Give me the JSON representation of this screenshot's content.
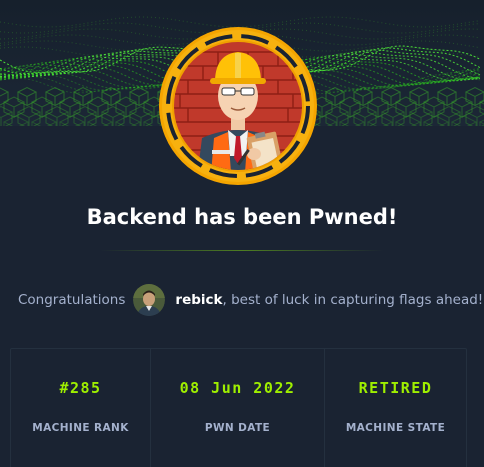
{
  "colors": {
    "background": "#1a2332",
    "accent_green": "#9fef00",
    "muted_text": "#a4b1cd",
    "ring_orange": "#f5a500"
  },
  "banner": {
    "icon": "green-wireframe-landscape-art"
  },
  "machine": {
    "avatar_icon": "construction-worker-avatar-icon",
    "title": "Backend has been Pwned!"
  },
  "congrats": {
    "prefix": "Congratulations",
    "user_avatar_icon": "user-avatar-icon",
    "username": "rebick",
    "suffix": ", best of luck in capturing flags ahead!"
  },
  "stats": [
    {
      "value": "#285",
      "label": "MACHINE RANK"
    },
    {
      "value": "08 Jun 2022",
      "label": "PWN DATE"
    },
    {
      "value": "RETIRED",
      "label": "MACHINE STATE"
    }
  ]
}
